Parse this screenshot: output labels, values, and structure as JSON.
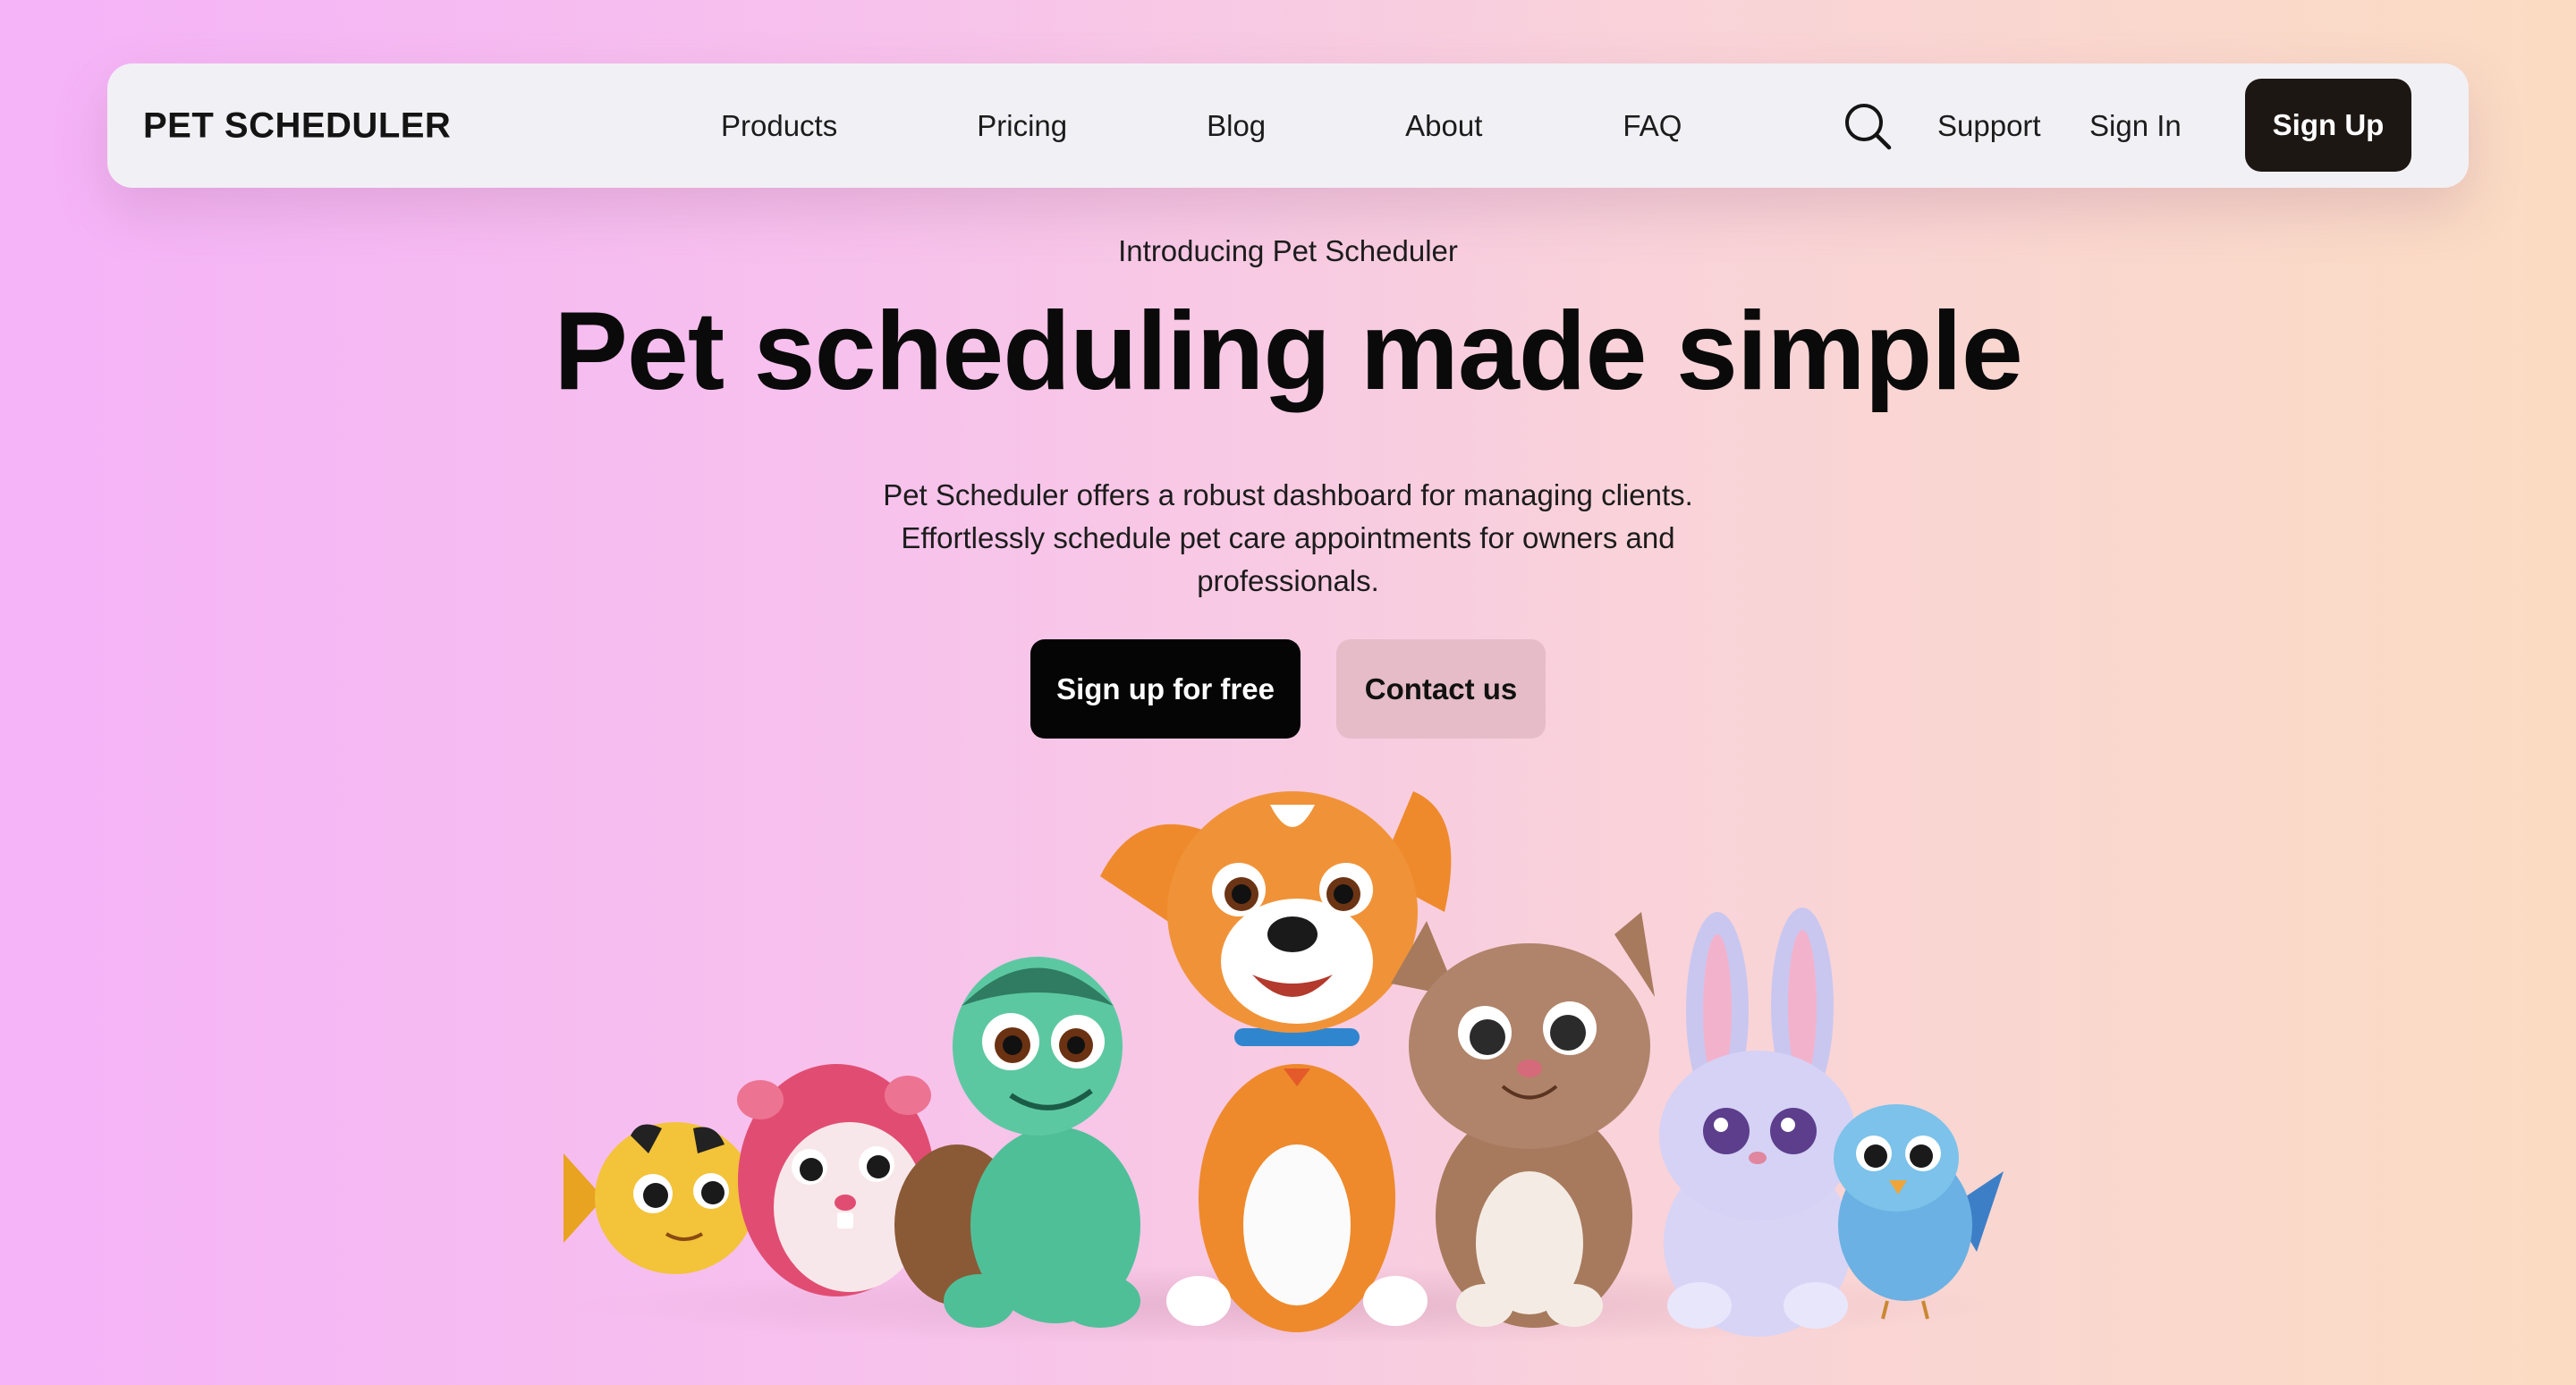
{
  "nav": {
    "brand": "PET SCHEDULER",
    "links": [
      "Products",
      "Pricing",
      "Blog",
      "About",
      "FAQ"
    ],
    "search_icon": "search-icon",
    "support": "Support",
    "sign_in": "Sign In",
    "sign_up": "Sign Up"
  },
  "hero": {
    "eyebrow": "Introducing Pet Scheduler",
    "headline": "Pet scheduling made simple",
    "subtext": "Pet Scheduler offers a robust dashboard for managing clients. Effortlessly schedule pet care appointments for owners and professionals.",
    "primary_cta": "Sign up for free",
    "secondary_cta": "Contact us"
  },
  "illustration": {
    "pets": [
      "fish",
      "guinea-pig",
      "turtle",
      "dog",
      "cat",
      "bunny",
      "bird"
    ]
  },
  "colors": {
    "nav_bg": "#f1f0f5",
    "signup_bg": "#1d1714",
    "primary_btn_bg": "#050505",
    "secondary_btn_bg": "#e5bcc8",
    "gradient_left": "#f5b3f8",
    "gradient_right": "#fbdcc2"
  }
}
